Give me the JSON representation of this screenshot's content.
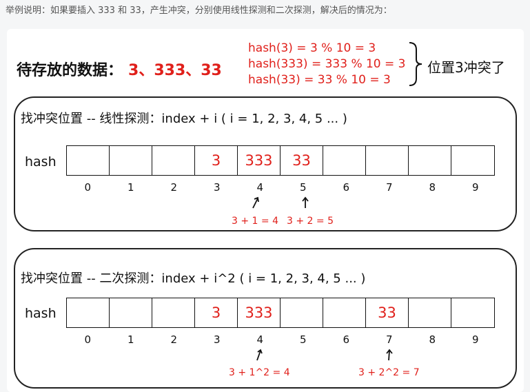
{
  "caption": "举例说明：如果要插入 333 和 33，产生冲突，分别使用线性探测和二次探测，解决后的情况为：",
  "header": {
    "data_label": "待存放的数据：",
    "data_values": "3、333、33",
    "hash_lines": [
      "hash(3) = 3 % 10 = 3",
      "hash(333) = 333 % 10 = 3",
      "hash(33) = 33 % 10 = 3"
    ],
    "conflict_note": "位置3冲突了"
  },
  "linear": {
    "title": "找冲突位置 -- 线性探测：index + i ( i = 1, 2, 3, 4, 5 ... )",
    "row_label": "hash",
    "cells": [
      "",
      "",
      "",
      "3",
      "333",
      "33",
      "",
      "",
      "",
      ""
    ],
    "indices": [
      "0",
      "1",
      "2",
      "3",
      "4",
      "5",
      "6",
      "7",
      "8",
      "9"
    ],
    "calc_1": "3 + 1 = 4",
    "calc_2": "3 + 2 = 5"
  },
  "quadratic": {
    "title": "找冲突位置 -- 二次探测：index + i^2 ( i = 1, 2, 3, 4, 5 ... )",
    "row_label": "hash",
    "cells": [
      "",
      "",
      "",
      "3",
      "333",
      "",
      "",
      "33",
      "",
      ""
    ],
    "indices": [
      "0",
      "1",
      "2",
      "3",
      "4",
      "5",
      "6",
      "7",
      "8",
      "9"
    ],
    "calc_1": "3 + 1^2 = 4",
    "calc_2": "3 + 2^2 = 7"
  }
}
